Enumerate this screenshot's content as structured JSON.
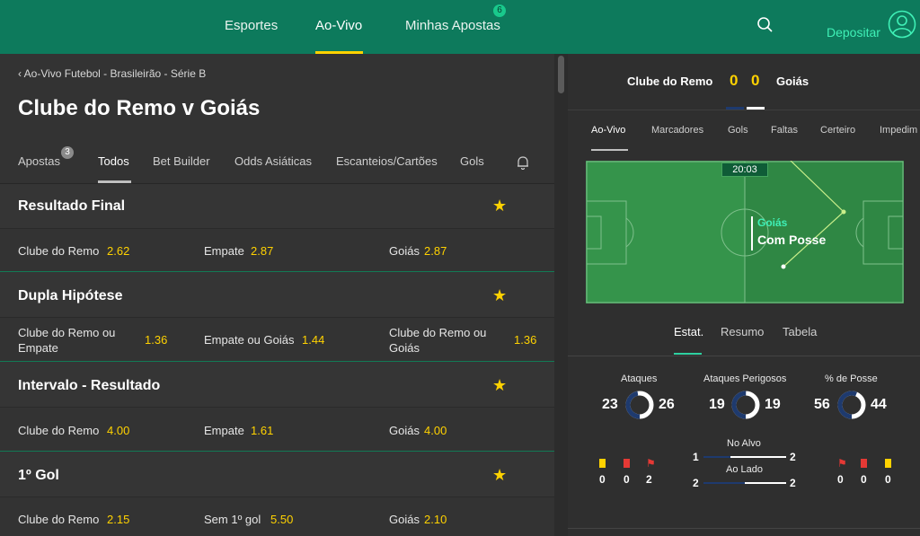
{
  "nav": {
    "sports": "Esportes",
    "live": "Ao-Vivo",
    "my_bets": "Minhas Apostas",
    "my_bets_badge": "6",
    "deposit": "Depositar",
    "accent": "#ffd200",
    "brand": "#0d7a5c"
  },
  "icons": {
    "search": "search-icon",
    "user": "user-circle-icon",
    "bell": "bell-icon",
    "star": "star-icon",
    "back": "chevron-left-icon",
    "flag": "corner-flag-icon"
  },
  "event": {
    "breadcrumb": "Ao-Vivo Futebol - Brasileirão - Série B",
    "title": "Clube do Remo v Goiás",
    "tabs": [
      {
        "label": "Apostas",
        "badge": "3"
      },
      {
        "label": "Todos"
      },
      {
        "label": "Bet Builder"
      },
      {
        "label": "Odds Asiáticas"
      },
      {
        "label": "Escanteios/Cartões"
      },
      {
        "label": "Gols"
      }
    ]
  },
  "markets": [
    {
      "title": "Resultado Final",
      "selections": [
        {
          "name": "Clube do Remo",
          "odd": "2.62"
        },
        {
          "name": "Empate",
          "odd": "2.87"
        },
        {
          "name": "Goiás",
          "odd": "2.87"
        }
      ]
    },
    {
      "title": "Dupla Hipótese",
      "selections": [
        {
          "name": "Clube do Remo ou",
          "name2": "Empate",
          "odd": "1.36"
        },
        {
          "name": "Empate ou Goiás",
          "odd": "1.44"
        },
        {
          "name": "Clube do Remo ou",
          "name2": "Goiás",
          "odd": "1.36"
        }
      ]
    },
    {
      "title": "Intervalo - Resultado",
      "selections": [
        {
          "name": "Clube do Remo",
          "odd": "4.00"
        },
        {
          "name": "Empate",
          "odd": "1.61"
        },
        {
          "name": "Goiás",
          "odd": "4.00"
        }
      ]
    },
    {
      "title": "1º Gol",
      "selections": [
        {
          "name": "Clube do Remo",
          "odd": "2.15"
        },
        {
          "name": "Sem 1º gol",
          "odd": "5.50"
        },
        {
          "name": "Goiás",
          "odd": "2.10"
        }
      ]
    }
  ],
  "scoreboard": {
    "home": "Clube do Remo",
    "away": "Goiás",
    "home_score": "0",
    "away_score": "0",
    "home_color": "#1e3a6e",
    "away_color": "#ffffff"
  },
  "match_tabs": [
    "Ao-Vivo",
    "Marcadores",
    "Gols",
    "Faltas",
    "Certeiro",
    "Impedim"
  ],
  "pitch": {
    "clock": "20:03",
    "team": "Goiás",
    "status": "Com Posse"
  },
  "stats_tabs": [
    "Estat.",
    "Resumo",
    "Tabela"
  ],
  "stats": {
    "attacks": {
      "label": "Ataques",
      "home": "23",
      "away": "26",
      "home_share": 0.47
    },
    "dangerous": {
      "label": "Ataques Perigosos",
      "home": "19",
      "away": "19",
      "home_share": 0.5
    },
    "possession": {
      "label": "% de Posse",
      "home": "56",
      "away": "44",
      "home_share": 0.56
    },
    "on_target": {
      "label": "No Alvo",
      "home": "1",
      "away": "2"
    },
    "off_target": {
      "label": "Ao Lado",
      "home": "2",
      "away": "2"
    },
    "home_cards": {
      "yellow": "0",
      "red": "0",
      "corners": "2"
    },
    "away_cards": {
      "corners": "0",
      "red": "0",
      "yellow": "0"
    }
  }
}
